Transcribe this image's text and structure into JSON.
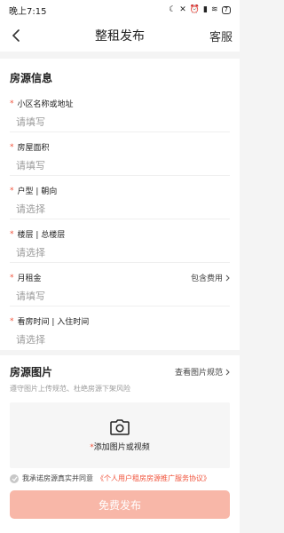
{
  "status_bar": {
    "time": "晚上7:15",
    "battery": "7"
  },
  "header": {
    "title": "整租发布",
    "service_label": "客服"
  },
  "form": {
    "section_title": "房源信息",
    "fields": [
      {
        "label": "小区名称或地址",
        "placeholder": "请填写",
        "required": true
      },
      {
        "label": "房屋面积",
        "placeholder": "请填写",
        "required": true
      },
      {
        "label": "户型 | 朝向",
        "placeholder": "请选择",
        "required": true
      },
      {
        "label": "楼层 | 总楼层",
        "placeholder": "请选择",
        "required": true
      },
      {
        "label": "月租金",
        "placeholder": "请填写",
        "required": true,
        "extra": "包含费用"
      },
      {
        "label": "看房时间 | 入住时间",
        "placeholder": "请选择",
        "required": true
      }
    ]
  },
  "photos": {
    "title": "房源图片",
    "link": "查看图片规范",
    "subtitle": "遵守图片上传规范、杜绝房源下架风险",
    "upload_label": "添加图片或视频"
  },
  "footer": {
    "agree_prefix": "我承诺房源真实并同意",
    "agree_link": "《个人用户租房房源推广服务协议》",
    "publish_label": "免费发布"
  },
  "colors": {
    "accent": "#f0533b",
    "button_disabled": "#f8b7a8",
    "placeholder": "#9b9b9b"
  }
}
